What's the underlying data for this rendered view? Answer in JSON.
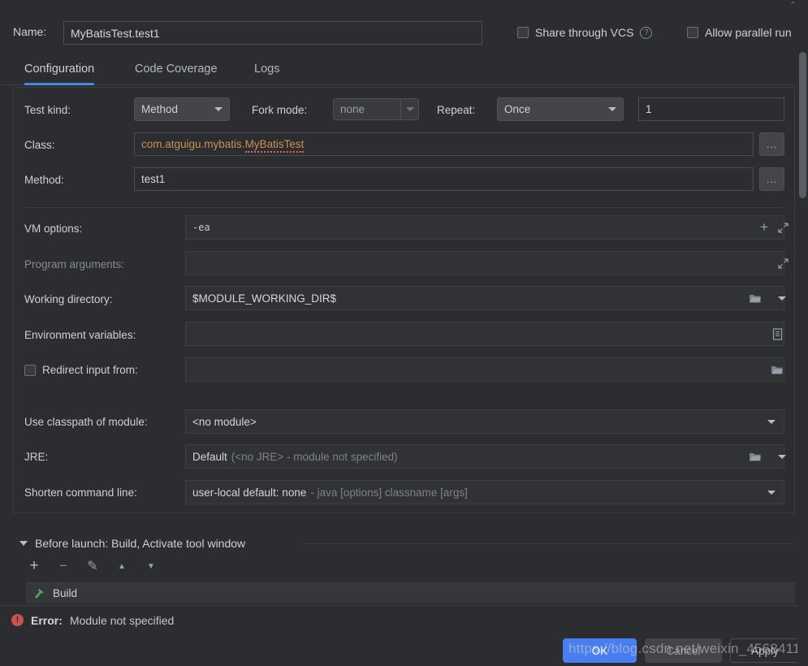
{
  "window": {
    "name_label": "Name:",
    "name_value": "MyBatisTest.test1"
  },
  "header_options": {
    "share_vcs_label": "Share through VCS",
    "share_vcs_checked": false,
    "help_icon": "help-circle-icon",
    "allow_parallel_label": "Allow parallel run",
    "allow_parallel_checked": false
  },
  "tabs": [
    {
      "label": "Configuration",
      "active": true
    },
    {
      "label": "Code Coverage",
      "active": false
    },
    {
      "label": "Logs",
      "active": false
    }
  ],
  "form": {
    "test_kind": {
      "label": "Test kind:",
      "value": "Method"
    },
    "fork_mode": {
      "label": "Fork mode:",
      "value": "none",
      "disabled": true
    },
    "repeat": {
      "label": "Repeat:",
      "value": "Once"
    },
    "repeat_count": {
      "value": "1"
    },
    "class": {
      "label": "Class:",
      "value_prefix": "com.atguigu.mybatis.",
      "value_error": "MyBatisTest",
      "browse_label": "..."
    },
    "method": {
      "label": "Method:",
      "value": "test1",
      "browse_label": "..."
    },
    "vm_options": {
      "label": "VM options:",
      "value": "-ea",
      "add_icon": "plus-icon",
      "expand_icon": "expand-icon"
    },
    "program_arguments": {
      "label": "Program arguments:",
      "value": "",
      "expand_icon": "expand-icon"
    },
    "working_directory": {
      "label": "Working directory:",
      "value": "$MODULE_WORKING_DIR$",
      "folder_icon": "folder-icon",
      "caret_icon": "chevron-down-icon"
    },
    "environment_variables": {
      "label": "Environment variables:",
      "value": "",
      "list_icon": "list-icon"
    },
    "redirect_input": {
      "label": "Redirect input from:",
      "checked": false,
      "value": "",
      "folder_icon": "folder-icon"
    },
    "use_classpath": {
      "label": "Use classpath of module:",
      "value": "<no module>",
      "caret_icon": "chevron-down-icon"
    },
    "jre": {
      "label": "JRE:",
      "value_main": "Default",
      "value_hint": "(<no JRE> - module not specified)",
      "folder_icon": "folder-icon",
      "caret_icon": "chevron-down-icon"
    },
    "shorten_command_line": {
      "label": "Shorten command line:",
      "value_main": "user-local default: none",
      "value_hint": "- java [options] classname [args]",
      "caret_icon": "chevron-down-icon"
    }
  },
  "before_launch": {
    "title": "Before launch: Build, Activate tool window",
    "collapse_icon": "triangle-down-icon",
    "toolbar": [
      {
        "name": "add-icon",
        "glyph": "+"
      },
      {
        "name": "remove-icon",
        "glyph": "−"
      },
      {
        "name": "edit-pencil-icon",
        "glyph": "✎"
      },
      {
        "name": "move-up-icon",
        "glyph": "▲"
      },
      {
        "name": "move-down-icon",
        "glyph": "▼"
      }
    ],
    "items": [
      {
        "label": "Build",
        "icon": "hammer-icon"
      }
    ]
  },
  "error": {
    "icon": "error-circle-icon",
    "prefix": "Error:",
    "message": "Module not specified"
  },
  "buttons": {
    "ok": "OK",
    "cancel": "Cancel",
    "apply": "Apply"
  },
  "watermark": {
    "text": "https://blog.csdn.net/weixin_45684111"
  },
  "colors": {
    "accent": "#4a88e0",
    "primary_button": "#4a7ef0",
    "error": "#c75450",
    "class_text": "#cc9152",
    "background": "#2b2d30"
  }
}
